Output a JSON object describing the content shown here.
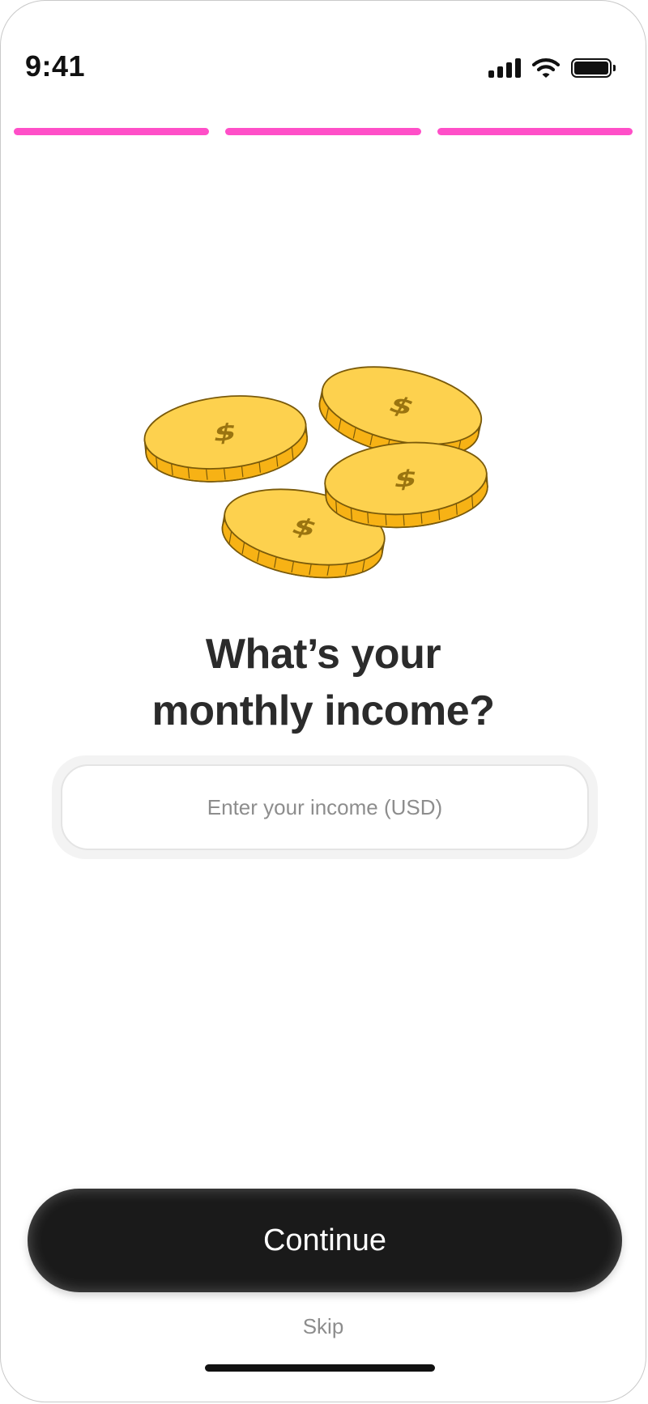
{
  "status_bar": {
    "time": "9:41",
    "icons": [
      "cellular-signal-icon",
      "wifi-icon",
      "battery-icon"
    ]
  },
  "progress": {
    "total_steps": 3,
    "completed_steps": 3,
    "color": "#FF4FC8"
  },
  "illustration": {
    "icon": "gold-coins-icon",
    "coin_glyph": "$",
    "coin_color": "#FDD14E",
    "coin_edge_color": "#F7B215"
  },
  "question": {
    "line1": "What’s your",
    "line2": "monthly income?"
  },
  "income_input": {
    "value": "",
    "placeholder": "Enter your income (USD)"
  },
  "actions": {
    "continue_label": "Continue",
    "skip_label": "Skip"
  },
  "colors": {
    "primary_button": "#1A1A1A",
    "accent": "#FF4FC8",
    "text": "#2B2B2B",
    "muted": "#8D8D8D"
  }
}
